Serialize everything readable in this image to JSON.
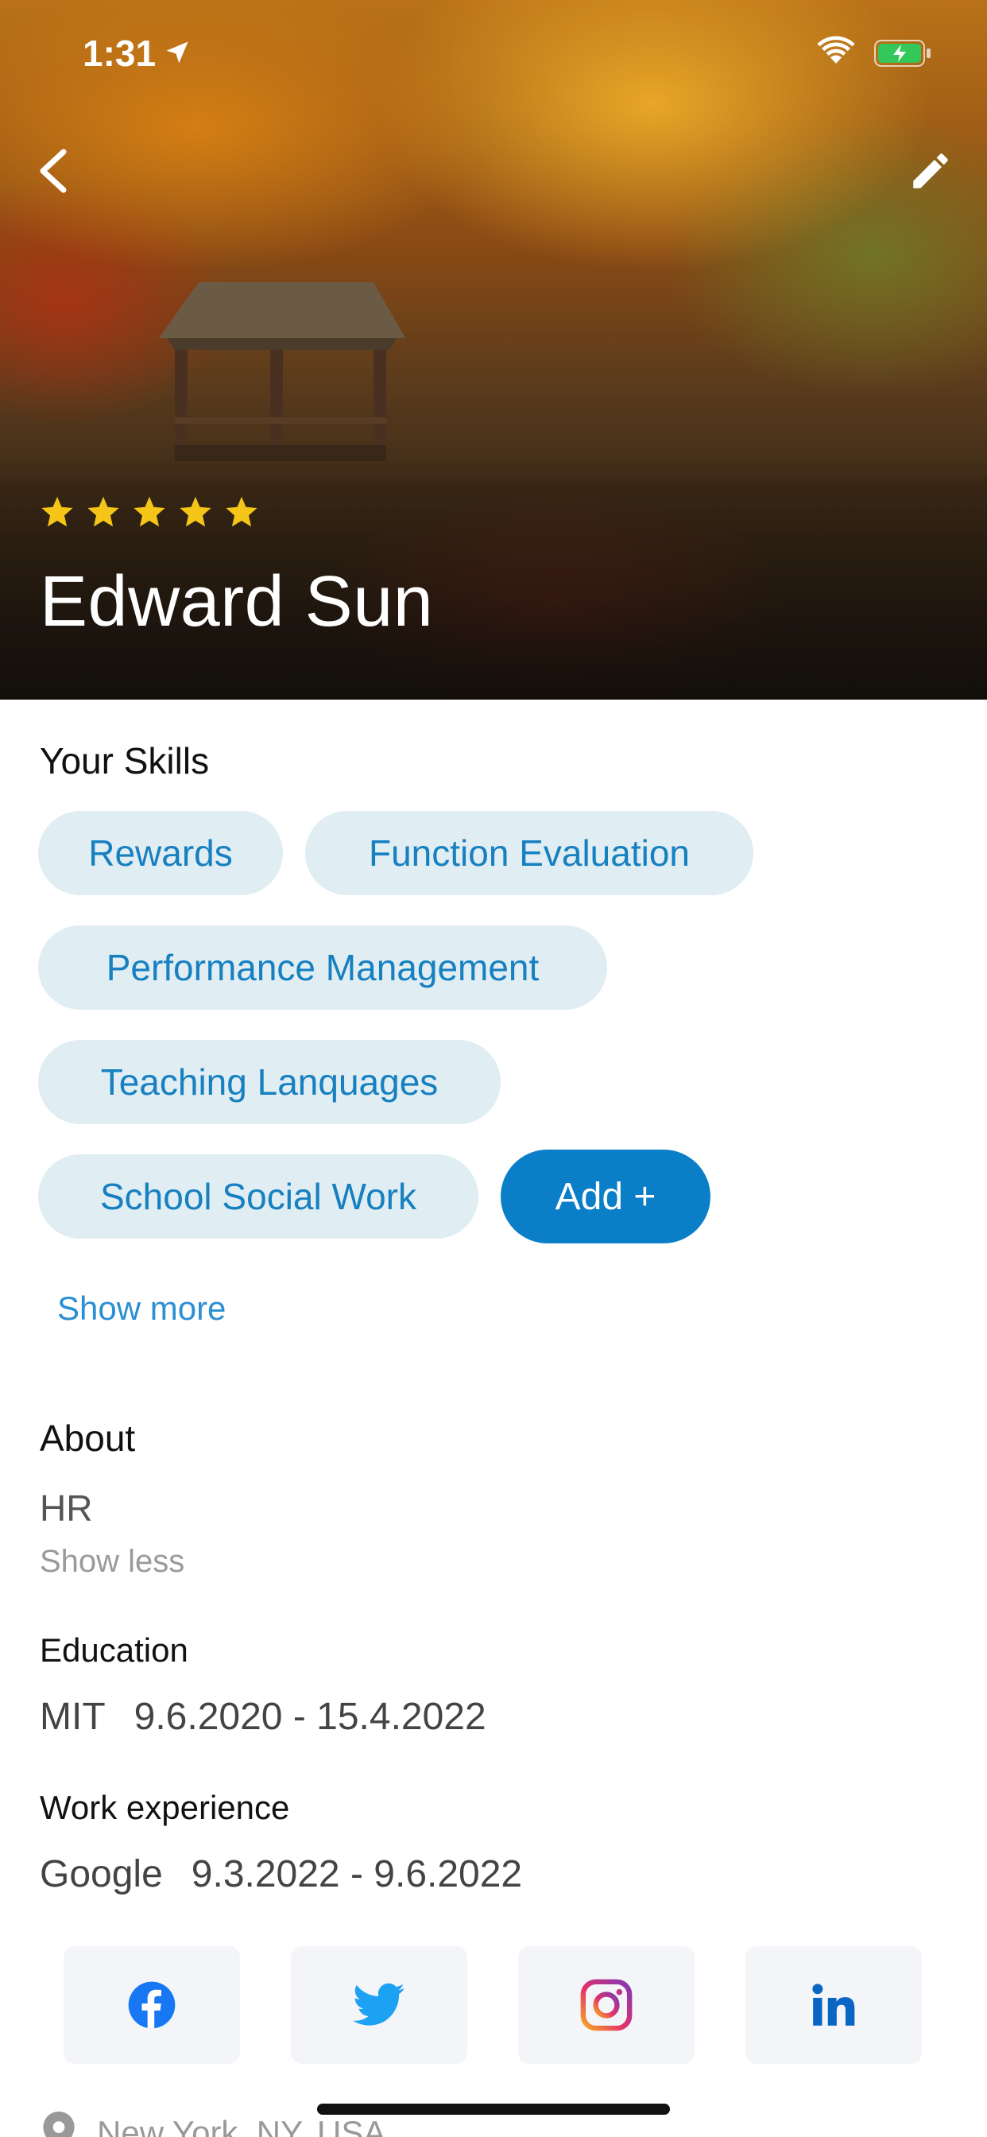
{
  "status_bar": {
    "time": "1:31",
    "icons": [
      "location-arrow-icon",
      "wifi-icon",
      "battery-charging-icon"
    ]
  },
  "header": {
    "back_icon": "chevron-left-icon",
    "edit_icon": "pencil-icon"
  },
  "profile": {
    "name": "Edward Sun",
    "rating": 5,
    "rating_max": 5
  },
  "skills": {
    "title": "Your Skills",
    "items": [
      "Rewards",
      "Function Evaluation",
      "Performance Management",
      "Teaching Lanquages",
      "School Social Work"
    ],
    "add_label": "Add +",
    "show_more_label": "Show more"
  },
  "about": {
    "title": "About",
    "text": "HR",
    "show_less_label": "Show less"
  },
  "education": {
    "title": "Education",
    "school": "MIT",
    "dates": "9.6.2020 - 15.4.2022"
  },
  "work_experience": {
    "title": "Work experience",
    "company": "Google",
    "dates": "9.3.2022 - 9.6.2022"
  },
  "social_links": [
    {
      "name": "facebook",
      "icon": "facebook-icon",
      "color": "#1877f2"
    },
    {
      "name": "twitter",
      "icon": "twitter-icon",
      "color": "#1da1f2"
    },
    {
      "name": "instagram",
      "icon": "instagram-icon",
      "color": "#c13584"
    },
    {
      "name": "linkedin",
      "icon": "linkedin-icon",
      "color": "#0a66c2"
    }
  ],
  "location": {
    "icon": "map-pin-icon",
    "text": "New York, NY, USA"
  },
  "colors": {
    "chip_bg": "#e0edf3",
    "chip_text": "#1680c0",
    "accent": "#0a7fc7",
    "star": "#f5c518"
  }
}
